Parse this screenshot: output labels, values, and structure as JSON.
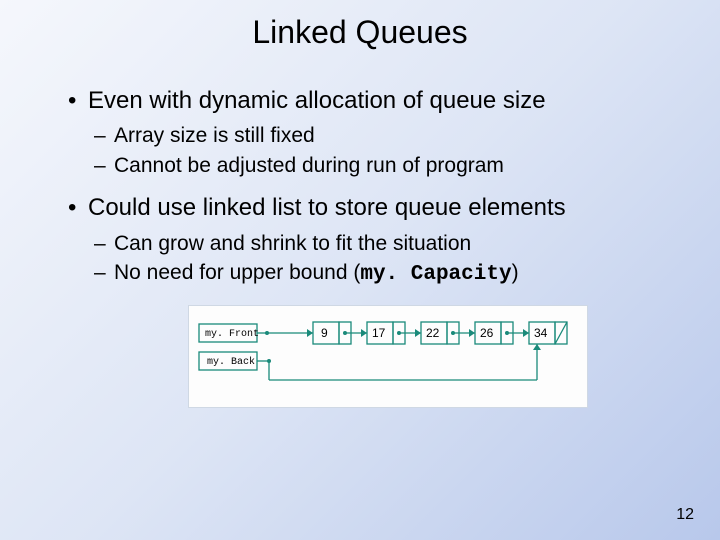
{
  "title": "Linked Queues",
  "bullets": [
    {
      "text": "Even with dynamic allocation of queue size",
      "sub": [
        "Array size is still fixed",
        "Cannot be adjusted during run of program"
      ]
    },
    {
      "text": "Could use linked list to store queue elements",
      "sub": [
        "Can grow and shrink to fit the situation",
        "No need for upper bound (my. Capacity)"
      ],
      "code_token": "my. Capacity"
    }
  ],
  "diagram": {
    "front_label": "my. Front",
    "back_label": "my. Back",
    "nodes": [
      "9",
      "17",
      "22",
      "26",
      "34"
    ]
  },
  "page_number": "12"
}
